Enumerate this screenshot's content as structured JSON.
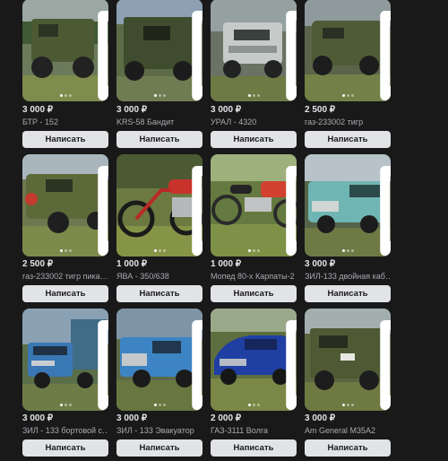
{
  "card_action_label": "Написать",
  "gallery": {
    "dots": 3,
    "active": 1
  },
  "listings": [
    {
      "price": "3 000 ₽",
      "title": "БТР - 152",
      "image": "green-armored-truck-photo"
    },
    {
      "price": "3 000 ₽",
      "title": "KRS-58 Бандит",
      "image": "green-military-truck-photo"
    },
    {
      "price": "3 000 ₽",
      "title": "УРАЛ - 4320",
      "image": "white-ural-truck-photo"
    },
    {
      "price": "2 500 ₽",
      "title": "газ-233002 тигр",
      "image": "camo-tigr-vehicle-photo"
    },
    {
      "price": "2 500 ₽",
      "title": "газ-233002 тигр пика…",
      "image": "camo-tigr-pickup-photo"
    },
    {
      "price": "1 000 ₽",
      "title": "ЯВА - 350/638",
      "image": "red-jawa-motorcycle-photo"
    },
    {
      "price": "1 000 ₽",
      "title": "Мопед 80-х Карпаты-2",
      "image": "red-moped-photo"
    },
    {
      "price": "3 000 ₽",
      "title": "ЗИЛ-133 двойная каб…",
      "image": "teal-zil-double-cab-photo"
    },
    {
      "price": "3 000 ₽",
      "title": "ЗИЛ - 133 бортовой с…",
      "image": "blue-zil-flatbed-photo"
    },
    {
      "price": "3 000 ₽",
      "title": "ЗИЛ - 133 Эвакуатор",
      "image": "blue-zil-tow-truck-photo"
    },
    {
      "price": "2 000 ₽",
      "title": "ГАЗ-3111 Волга",
      "image": "blue-volga-car-photo"
    },
    {
      "price": "3 000 ₽",
      "title": "Am General M35A2",
      "image": "green-m35a2-truck-photo"
    }
  ]
}
